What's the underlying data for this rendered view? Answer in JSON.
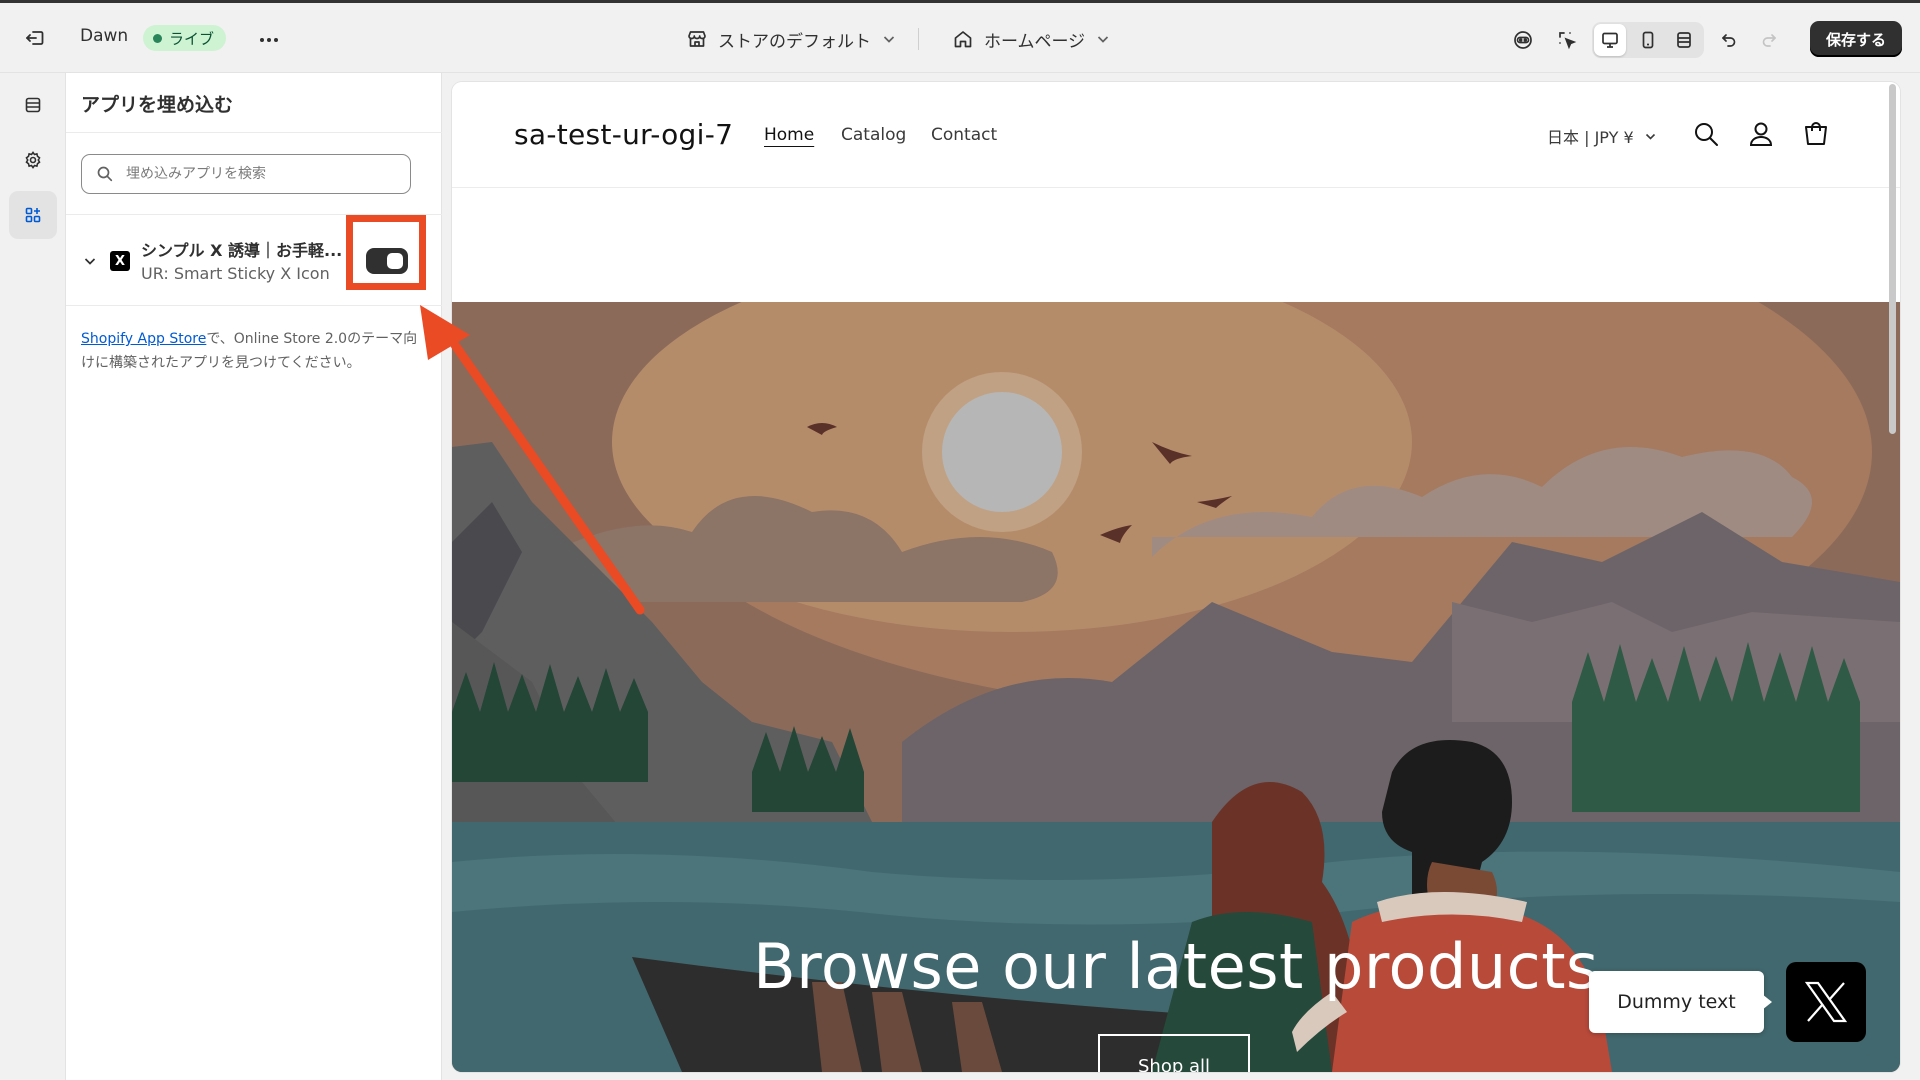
{
  "topbar": {
    "theme_name": "Dawn",
    "live_badge": "ライブ",
    "store_selector": "ストアのデフォルト",
    "page_selector": "ホームページ",
    "save_label": "保存する"
  },
  "rail": {
    "items": [
      {
        "name": "sections",
        "icon": "sections-icon"
      },
      {
        "name": "theme-settings",
        "icon": "gear-icon"
      },
      {
        "name": "app-embeds",
        "icon": "app-embed-icon",
        "active": true
      }
    ]
  },
  "panel": {
    "title": "アプリを埋め込む",
    "search_placeholder": "埋め込みアプリを検索",
    "app": {
      "name": "シンプル X 誘導｜お手軽...",
      "subtitle": "UR: Smart Sticky X Icon",
      "enabled": true
    },
    "note_link": "Shopify App Store",
    "note_text": "で、Online Store 2.0のテーマ向けに構築されたアプリを見つけてください。"
  },
  "preview": {
    "store_name": "sa-test-ur-ogi-7",
    "nav": [
      "Home",
      "Catalog",
      "Contact"
    ],
    "currency": "日本 | JPY ¥",
    "hero_title": "Browse our latest products",
    "hero_button": "Shop all",
    "tooltip_text": "Dummy text"
  },
  "colors": {
    "annotation": "#ea4a24",
    "save_button": "#303030",
    "live_badge_bg": "#cdf3d2",
    "link": "#005bd3"
  }
}
